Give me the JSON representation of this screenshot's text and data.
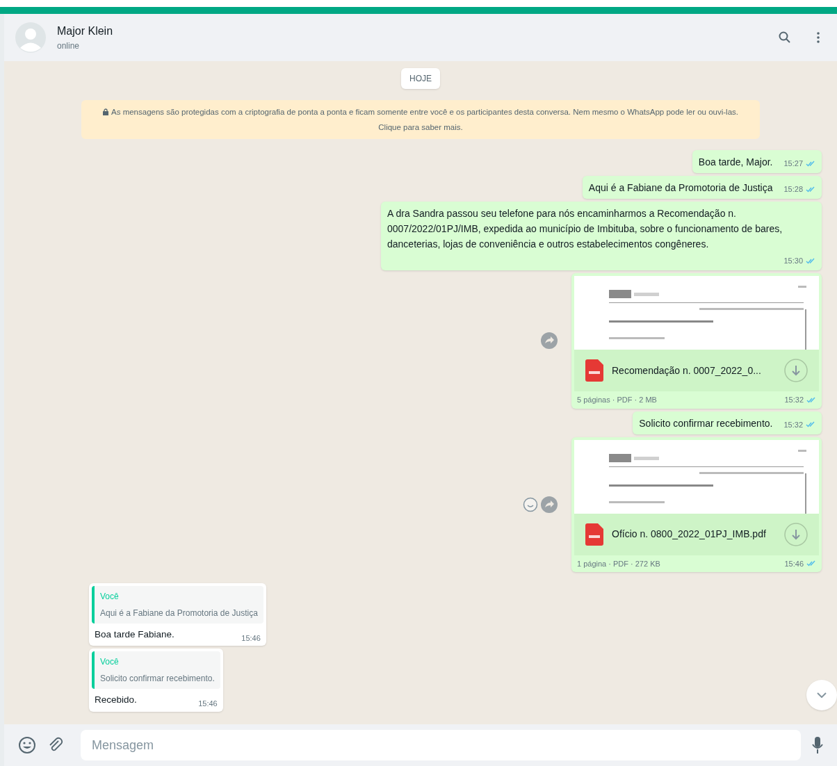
{
  "contact": {
    "name": "Major Klein",
    "status": "online"
  },
  "date_chip": "HOJE",
  "encryption_notice": "As mensagens são protegidas com a criptografia de ponta a ponta e ficam somente entre você e os participantes desta conversa. Nem mesmo o WhatsApp pode ler ou ouvi-las. Clique para saber mais.",
  "messages": [
    {
      "kind": "text",
      "outgoing": true,
      "text": "Boa tarde, Major.",
      "time": "15:27",
      "read": true
    },
    {
      "kind": "text",
      "outgoing": true,
      "text": "Aqui é a Fabiane da Promotoria de Justiça",
      "time": "15:28",
      "read": true
    },
    {
      "kind": "text",
      "outgoing": true,
      "text": "A dra Sandra passou seu telefone para nós encaminharmos a Recomendação n. 0007/2022/01PJ/IMB, expedida ao município de Imbituba, sobre o funcionamento de bares, danceterias, lojas de conveniência e outros estabelecimentos congêneres.",
      "time": "15:30",
      "read": true
    },
    {
      "kind": "document",
      "outgoing": true,
      "file_name": "Recomendação n. 0007_2022_0...",
      "meta": "5 páginas · PDF · 2 MB",
      "time": "15:32",
      "read": true,
      "react_button": false
    },
    {
      "kind": "text",
      "outgoing": true,
      "text": "Solicito confirmar recebimento.",
      "time": "15:32",
      "read": true
    },
    {
      "kind": "document",
      "outgoing": true,
      "file_name": "Ofício n. 0800_2022_01PJ_IMB.pdf",
      "meta": "1 página · PDF · 272 KB",
      "time": "15:46",
      "read": true,
      "react_button": true
    },
    {
      "kind": "reply",
      "outgoing": false,
      "quote_author": "Você",
      "quote_text": "Aqui é a Fabiane da Promotoria de Justiça",
      "text": "Boa tarde Fabiane.",
      "time": "15:46"
    },
    {
      "kind": "reply",
      "outgoing": false,
      "quote_author": "Você",
      "quote_text": "Solicito confirmar recebimento.",
      "text": "Recebido.",
      "time": "15:46"
    }
  ],
  "composer": {
    "placeholder": "Mensagem"
  }
}
